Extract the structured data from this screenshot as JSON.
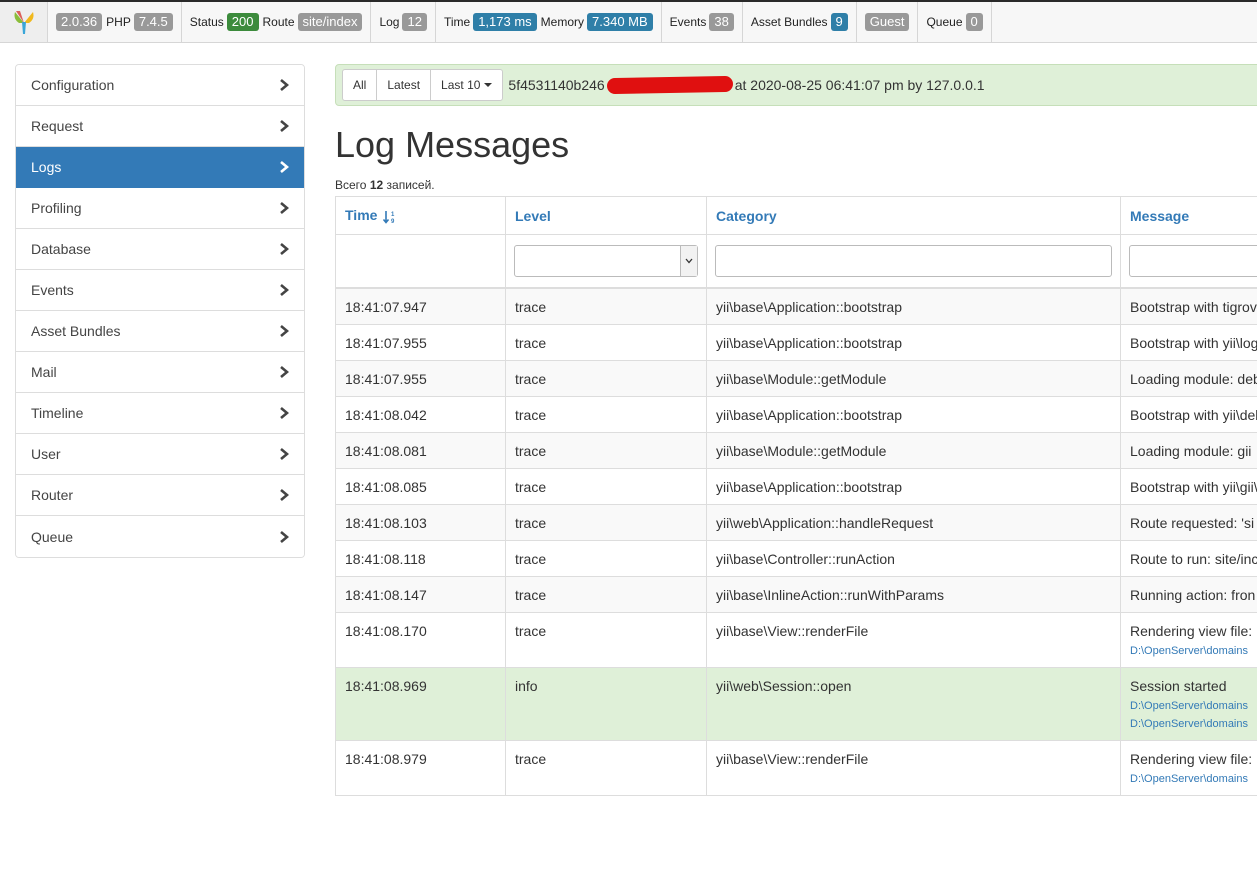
{
  "toolbar": {
    "yii_version": "2.0.36",
    "php_label": "PHP",
    "php_version": "7.4.5",
    "status_label": "Status",
    "status_code": "200",
    "route_label": "Route",
    "route_value": "site/index",
    "log_label": "Log",
    "log_count": "12",
    "time_label": "Time",
    "time_value": "1,173 ms",
    "memory_label": "Memory",
    "memory_value": "7.340 MB",
    "events_label": "Events",
    "events_count": "38",
    "bundles_label": "Asset Bundles",
    "bundles_count": "9",
    "user_value": "Guest",
    "queue_label": "Queue",
    "queue_count": "0",
    "colors": {
      "green": "#3c8b3c",
      "blue": "#337ab7",
      "gray": "#999999"
    }
  },
  "sidebar": {
    "items": [
      {
        "label": "Configuration"
      },
      {
        "label": "Request"
      },
      {
        "label": "Logs",
        "active": true
      },
      {
        "label": "Profiling"
      },
      {
        "label": "Database"
      },
      {
        "label": "Events"
      },
      {
        "label": "Asset Bundles"
      },
      {
        "label": "Mail"
      },
      {
        "label": "Timeline"
      },
      {
        "label": "User"
      },
      {
        "label": "Router"
      },
      {
        "label": "Queue"
      }
    ]
  },
  "request_bar": {
    "btn_all": "All",
    "btn_latest": "Latest",
    "btn_last10": "Last 10",
    "tag_prefix": "5f4531140b246",
    "tag_suffix": "at 2020-08-25 06:41:07 pm by 127.0.0.1"
  },
  "page": {
    "title": "Log Messages",
    "summary_prefix": "Всего",
    "summary_count": "12",
    "summary_suffix": "записей."
  },
  "table": {
    "columns": [
      "Time",
      "Level",
      "Category",
      "Message"
    ],
    "rows": [
      {
        "time": "18:41:07.947",
        "level": "trace",
        "category": "yii\\base\\Application::bootstrap",
        "message": "Bootstrap with tigrov",
        "links": []
      },
      {
        "time": "18:41:07.955",
        "level": "trace",
        "category": "yii\\base\\Application::bootstrap",
        "message": "Bootstrap with yii\\log",
        "links": []
      },
      {
        "time": "18:41:07.955",
        "level": "trace",
        "category": "yii\\base\\Module::getModule",
        "message": "Loading module: deb",
        "links": []
      },
      {
        "time": "18:41:08.042",
        "level": "trace",
        "category": "yii\\base\\Application::bootstrap",
        "message": "Bootstrap with yii\\deb",
        "links": []
      },
      {
        "time": "18:41:08.081",
        "level": "trace",
        "category": "yii\\base\\Module::getModule",
        "message": "Loading module: gii",
        "links": []
      },
      {
        "time": "18:41:08.085",
        "level": "trace",
        "category": "yii\\base\\Application::bootstrap",
        "message": "Bootstrap with yii\\gii\\",
        "links": []
      },
      {
        "time": "18:41:08.103",
        "level": "trace",
        "category": "yii\\web\\Application::handleRequest",
        "message": "Route requested: 'si",
        "links": []
      },
      {
        "time": "18:41:08.118",
        "level": "trace",
        "category": "yii\\base\\Controller::runAction",
        "message": "Route to run: site/inc",
        "links": []
      },
      {
        "time": "18:41:08.147",
        "level": "trace",
        "category": "yii\\base\\InlineAction::runWithParams",
        "message": "Running action: fron",
        "links": []
      },
      {
        "time": "18:41:08.170",
        "level": "trace",
        "category": "yii\\base\\View::renderFile",
        "message": "Rendering view file:",
        "links": [
          "D:\\OpenServer\\domains"
        ]
      },
      {
        "time": "18:41:08.969",
        "level": "info",
        "category": "yii\\web\\Session::open",
        "message": "Session started",
        "links": [
          "D:\\OpenServer\\domains",
          "D:\\OpenServer\\domains"
        ]
      },
      {
        "time": "18:41:08.979",
        "level": "trace",
        "category": "yii\\base\\View::renderFile",
        "message": "Rendering view file:",
        "links": [
          "D:\\OpenServer\\domains"
        ]
      }
    ]
  },
  "icons": {
    "logo": "yii-logo-icon",
    "nav_arrow": "chevron-right-icon",
    "sort": "sort-numeric-asc-icon",
    "dropdown": "caret-down-icon"
  }
}
